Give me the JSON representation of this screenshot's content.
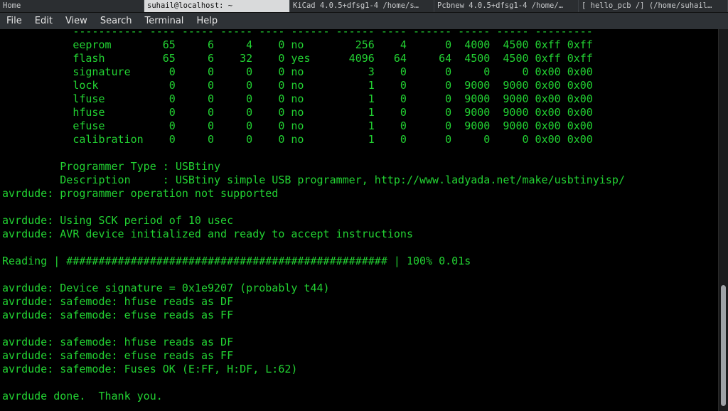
{
  "taskbar": {
    "items": [
      {
        "label": "Home",
        "active": false
      },
      {
        "label": "suhail@localhost: ~",
        "active": true
      },
      {
        "label": "KiCad 4.0.5+dfsg1-4 /home/s…",
        "active": false
      },
      {
        "label": "Pcbnew 4.0.5+dfsg1-4 /home/…",
        "active": false
      },
      {
        "label": "[ hello_pcb /] (/home/suhail…",
        "active": false
      }
    ]
  },
  "menubar": {
    "items": [
      "File",
      "Edit",
      "View",
      "Search",
      "Terminal",
      "Help"
    ]
  },
  "terminal": {
    "lines": [
      "           ----------- ---- ----- ----- ---- ------ ------ ---- ------ ----- ----- ---------",
      "           eeprom        65     6     4    0 no        256    4      0  4000  4500 0xff 0xff",
      "           flash         65     6    32    0 yes      4096   64     64  4500  4500 0xff 0xff",
      "           signature      0     0     0    0 no          3    0      0     0     0 0x00 0x00",
      "           lock           0     0     0    0 no          1    0      0  9000  9000 0x00 0x00",
      "           lfuse          0     0     0    0 no          1    0      0  9000  9000 0x00 0x00",
      "           hfuse          0     0     0    0 no          1    0      0  9000  9000 0x00 0x00",
      "           efuse          0     0     0    0 no          1    0      0  9000  9000 0x00 0x00",
      "           calibration    0     0     0    0 no          1    0      0     0     0 0x00 0x00",
      "",
      "         Programmer Type : USBtiny",
      "         Description     : USBtiny simple USB programmer, http://www.ladyada.net/make/usbtinyisp/",
      "avrdude: programmer operation not supported",
      "",
      "avrdude: Using SCK period of 10 usec",
      "avrdude: AVR device initialized and ready to accept instructions",
      "",
      "Reading | ################################################## | 100% 0.01s",
      "",
      "avrdude: Device signature = 0x1e9207 (probably t44)",
      "avrdude: safemode: hfuse reads as DF",
      "avrdude: safemode: efuse reads as FF",
      "",
      "avrdude: safemode: hfuse reads as DF",
      "avrdude: safemode: efuse reads as FF",
      "avrdude: safemode: Fuses OK (E:FF, H:DF, L:62)",
      "",
      "avrdude done.  Thank you."
    ]
  },
  "colors": {
    "terminal_text": "#22d232",
    "terminal_bg": "#000000",
    "menubar_bg": "#2e3236",
    "taskbar_bg": "#2b2e31",
    "active_task_bg": "#d9dadb"
  }
}
